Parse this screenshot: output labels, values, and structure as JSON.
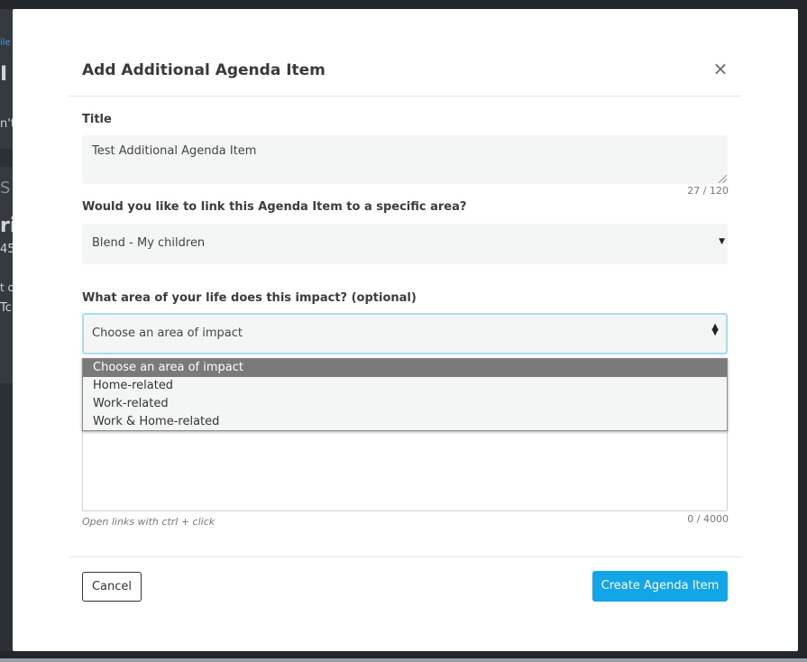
{
  "background": {
    "fragments": [
      "ile",
      "I",
      "n't",
      "S",
      "ri",
      "45",
      "t c",
      "Tc"
    ]
  },
  "modal": {
    "title": "Add Additional Agenda Item",
    "close_glyph": "×"
  },
  "title_field": {
    "label": "Title",
    "value": "Test Additional Agenda Item",
    "counter": "27 / 120"
  },
  "area_field": {
    "label": "Would you like to link this Agenda Item to a specific area?",
    "selected": "Blend - My children",
    "caret_icon": "caret-down-icon"
  },
  "impact_field": {
    "label": "What area of your life does this impact? (optional)",
    "selected": "Choose an area of impact",
    "options": [
      "Choose an area of impact",
      "Home-related",
      "Work-related",
      "Work & Home-related"
    ],
    "highlighted_option": "Choose an area of impact"
  },
  "notes_field": {
    "hint": "Open links with ctrl + click",
    "counter": "0 / 4000"
  },
  "footer": {
    "cancel_label": "Cancel",
    "create_label": "Create Agenda Item"
  },
  "colors": {
    "primary": "#12a6e8",
    "focus_border": "#a8dcef",
    "field_bg": "#f4f6f5",
    "overlay": "#23272b"
  }
}
